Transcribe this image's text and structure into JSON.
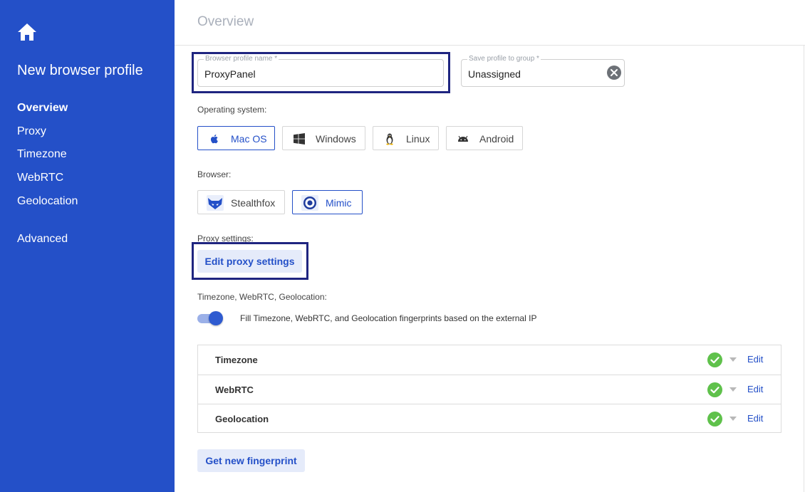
{
  "sidebar": {
    "home_icon": "home-icon",
    "title": "New browser profile",
    "items": [
      {
        "label": "Overview",
        "active": true
      },
      {
        "label": "Proxy"
      },
      {
        "label": "Timezone"
      },
      {
        "label": "WebRTC"
      },
      {
        "label": "Geolocation"
      },
      {
        "label": "Advanced"
      }
    ]
  },
  "main": {
    "page_title": "Overview",
    "profile_name": {
      "label": "Browser profile name *",
      "value": "ProxyPanel"
    },
    "group": {
      "label": "Save profile to group *",
      "value": "Unassigned",
      "clear_icon": "clear-icon"
    },
    "os": {
      "label": "Operating system:",
      "options": [
        {
          "label": "Mac OS",
          "icon": "apple-icon",
          "selected": true
        },
        {
          "label": "Windows",
          "icon": "windows-icon"
        },
        {
          "label": "Linux",
          "icon": "linux-penguin-icon"
        },
        {
          "label": "Android",
          "icon": "android-icon"
        }
      ]
    },
    "browser": {
      "label": "Browser:",
      "options": [
        {
          "label": "Stealthfox",
          "icon": "fox-icon"
        },
        {
          "label": "Mimic",
          "icon": "mimic-icon",
          "selected": true
        }
      ]
    },
    "proxy": {
      "label": "Proxy settings:",
      "button": "Edit proxy settings"
    },
    "fingerprint": {
      "label": "Timezone, WebRTC, Geolocation:",
      "toggle_on": true,
      "toggle_label": "Fill Timezone, WebRTC, and Geolocation fingerprints based on the external IP",
      "rows": [
        {
          "name": "Timezone",
          "edit": "Edit"
        },
        {
          "name": "WebRTC",
          "edit": "Edit"
        },
        {
          "name": "Geolocation",
          "edit": "Edit"
        }
      ],
      "new_button": "Get new fingerprint"
    },
    "colors": {
      "sidebar": "#2450c8",
      "accent": "#2450c8",
      "highlight": "#1f2580",
      "check": "#5fc14b"
    }
  }
}
